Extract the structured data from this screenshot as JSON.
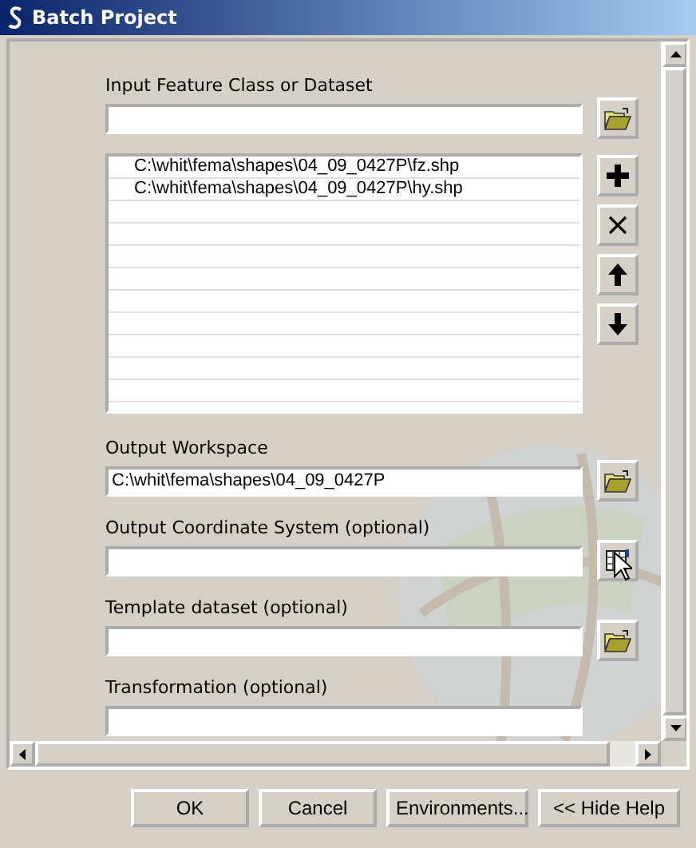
{
  "window": {
    "title": "Batch Project"
  },
  "fields": [
    {
      "kind": "text",
      "label": "Input Feature Class or Dataset",
      "button": {
        "kind": "folder"
      }
    },
    {
      "kind": "list",
      "items": [
        "C:\\whit\\fema\\shapes\\04_09_0427P\\fz.shp",
        "C:\\whit\\fema\\shapes\\04_09_0427P\\hy.shp"
      ],
      "buttons": [
        {
          "kind": "add"
        },
        {
          "kind": "remove"
        },
        {
          "kind": "up"
        },
        {
          "kind": "down"
        }
      ]
    },
    {
      "kind": "text",
      "label": "Output Workspace",
      "value": "C:\\whit\\fema\\shapes\\04_09_0427P",
      "button": {
        "kind": "folder"
      }
    },
    {
      "kind": "text",
      "label": "Output Coordinate System (optional)",
      "button": {
        "kind": "coordinate"
      }
    },
    {
      "kind": "text",
      "label": "Template dataset (optional)",
      "button": {
        "kind": "folder"
      }
    },
    {
      "kind": "text",
      "label": "Transformation (optional)"
    }
  ],
  "buttons": [
    "OK",
    "Cancel",
    "Environments...",
    "<< Hide Help"
  ]
}
